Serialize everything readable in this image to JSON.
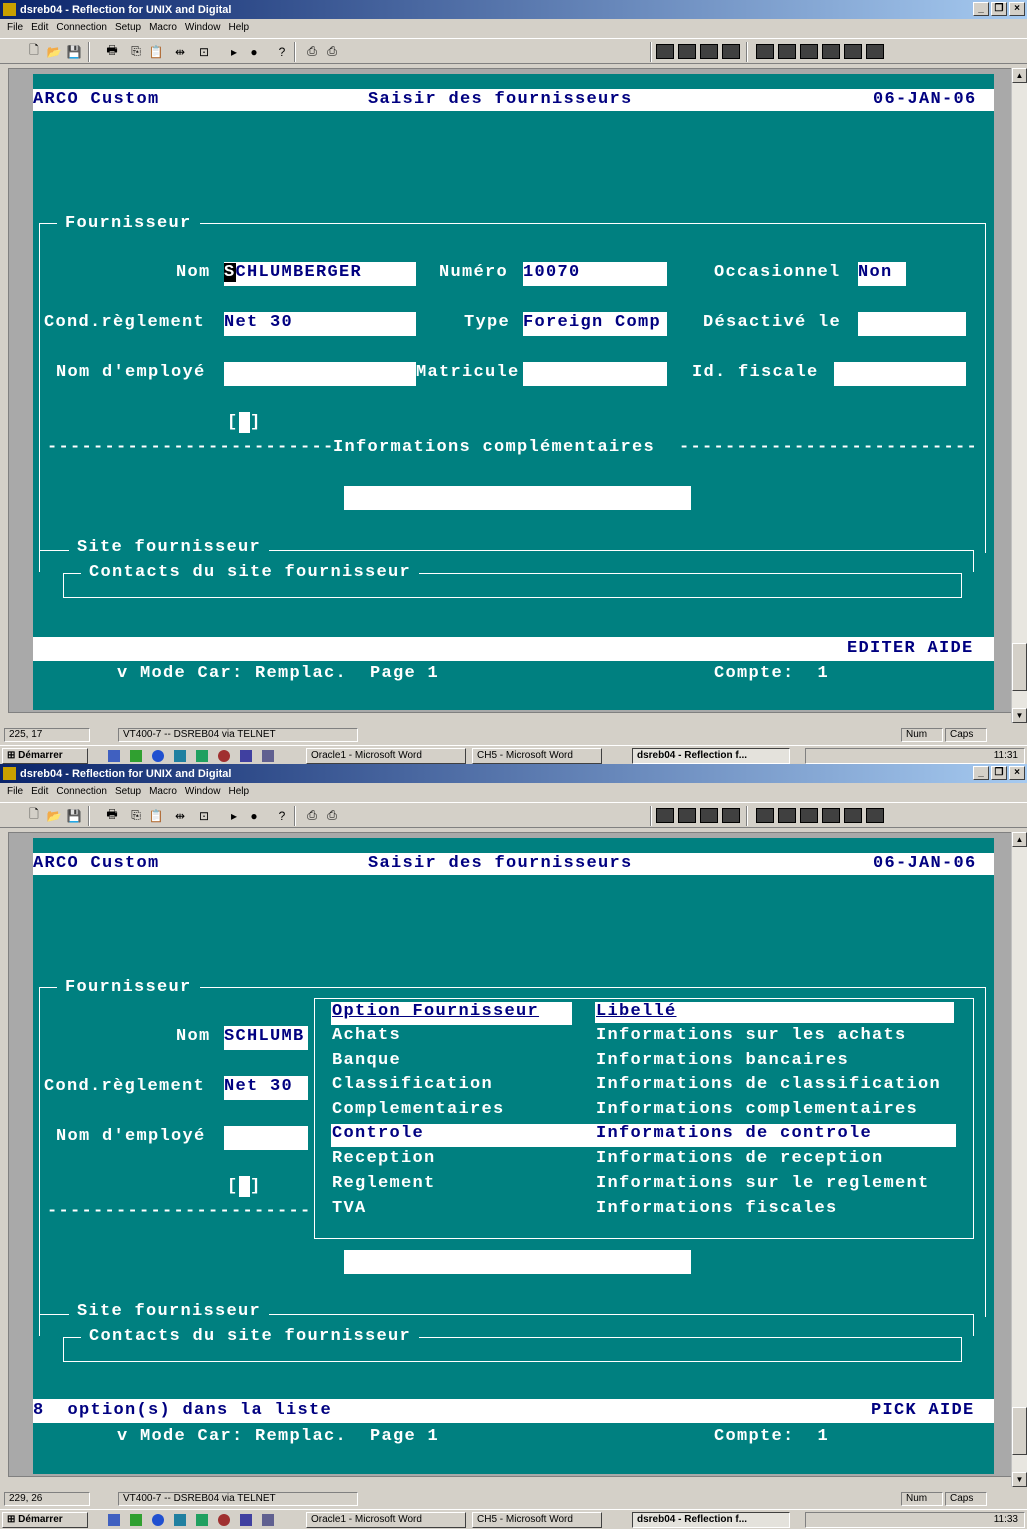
{
  "window1": {
    "title": "dsreb04 - Reflection for UNIX and Digital",
    "menu": [
      "File",
      "Edit",
      "Connection",
      "Setup",
      "Macro",
      "Window",
      "Help"
    ],
    "screen": {
      "app_name": "ARCO Custom",
      "form_title": "Saisir des fournisseurs",
      "date": "06-JAN-06",
      "section_fournisseur": "Fournisseur",
      "nom_label": "Nom",
      "nom_cursor": "S",
      "nom_value": "CHLUMBERGER",
      "numero_label": "Numéro",
      "numero_value": "10070",
      "occasionnel_label": "Occasionnel",
      "occasionnel_value": "Non",
      "cond_label": "Cond.règlement",
      "cond_value": "Net 30",
      "type_label": "Type",
      "type_value": "Foreign Comp",
      "desactive_label": "Désactivé le",
      "desactive_value": "",
      "employe_label": "Nom d'employé",
      "employe_value": "",
      "matricule_label": "Matricule",
      "matricule_value": "",
      "fiscale_label": "Id. fiscale",
      "fiscale_value": "",
      "checkbox_open": "[",
      "checkbox_close": "]",
      "info_comp": "Informations complémentaires",
      "site_fournisseur": "Site fournisseur",
      "contacts_site": "Contacts du site fournisseur",
      "keys": "EDITER AIDE",
      "mode_line": "v Mode Car: Remplac.  Page 1",
      "compte_line": "Compte:  1"
    },
    "status": {
      "position": "225, 17",
      "terminal": "VT400-7 -- DSREB04 via TELNET",
      "num": "Num",
      "caps": "Caps"
    },
    "taskbar": {
      "start": "Démarrer",
      "tasks": [
        "Oracle1 - Microsoft Word",
        "CH5 - Microsoft Word",
        "dsreb04 - Reflection f..."
      ],
      "clock": "11:31"
    }
  },
  "window2": {
    "title": "dsreb04 - Reflection for UNIX and Digital",
    "menu": [
      "File",
      "Edit",
      "Connection",
      "Setup",
      "Macro",
      "Window",
      "Help"
    ],
    "screen": {
      "app_name": "ARCO Custom",
      "form_title": "Saisir des fournisseurs",
      "date": "06-JAN-06",
      "section_fournisseur": "Fournisseur",
      "nom_label": "Nom",
      "nom_value": "SCHLUMB",
      "cond_label": "Cond.règlement",
      "cond_value": "Net 30",
      "employe_label": "Nom d'employé",
      "checkbox_open": "[",
      "checkbox_close": "]",
      "site_fournisseur": "Site fournisseur",
      "contacts_site": "Contacts du site fournisseur",
      "list_count": "8  option(s) dans la liste",
      "keys": "PICK AIDE",
      "mode_line": "v Mode Car: Remplac.  Page 1",
      "compte_line": "Compte:  1",
      "popup": {
        "header_option": "Option Fournisseur",
        "header_libelle": "Libellé",
        "rows": [
          {
            "option": "Achats",
            "libelle": "Informations sur les achats"
          },
          {
            "option": "Banque",
            "libelle": "Informations bancaires"
          },
          {
            "option": "Classification",
            "libelle": "Informations de classification"
          },
          {
            "option": "Complementaires",
            "libelle": "Informations complementaires"
          },
          {
            "option": "Controle",
            "libelle": "Informations de controle"
          },
          {
            "option": "Reception",
            "libelle": "Informations de reception"
          },
          {
            "option": "Reglement",
            "libelle": "Informations sur le reglement"
          },
          {
            "option": "TVA",
            "libelle": "Informations fiscales"
          }
        ],
        "selected_index": 4
      }
    },
    "status": {
      "position": "229, 26",
      "terminal": "VT400-7 -- DSREB04 via TELNET",
      "num": "Num",
      "caps": "Caps"
    },
    "taskbar": {
      "start": "Démarrer",
      "tasks": [
        "Oracle1 - Microsoft Word",
        "CH5 - Microsoft Word",
        "dsreb04 - Reflection f..."
      ],
      "clock": "11:33"
    }
  },
  "colors": {
    "terminal_bg": "#008080",
    "field_bg": "#ffffff",
    "field_text": "#000080",
    "title_bar": "#0a246a"
  }
}
